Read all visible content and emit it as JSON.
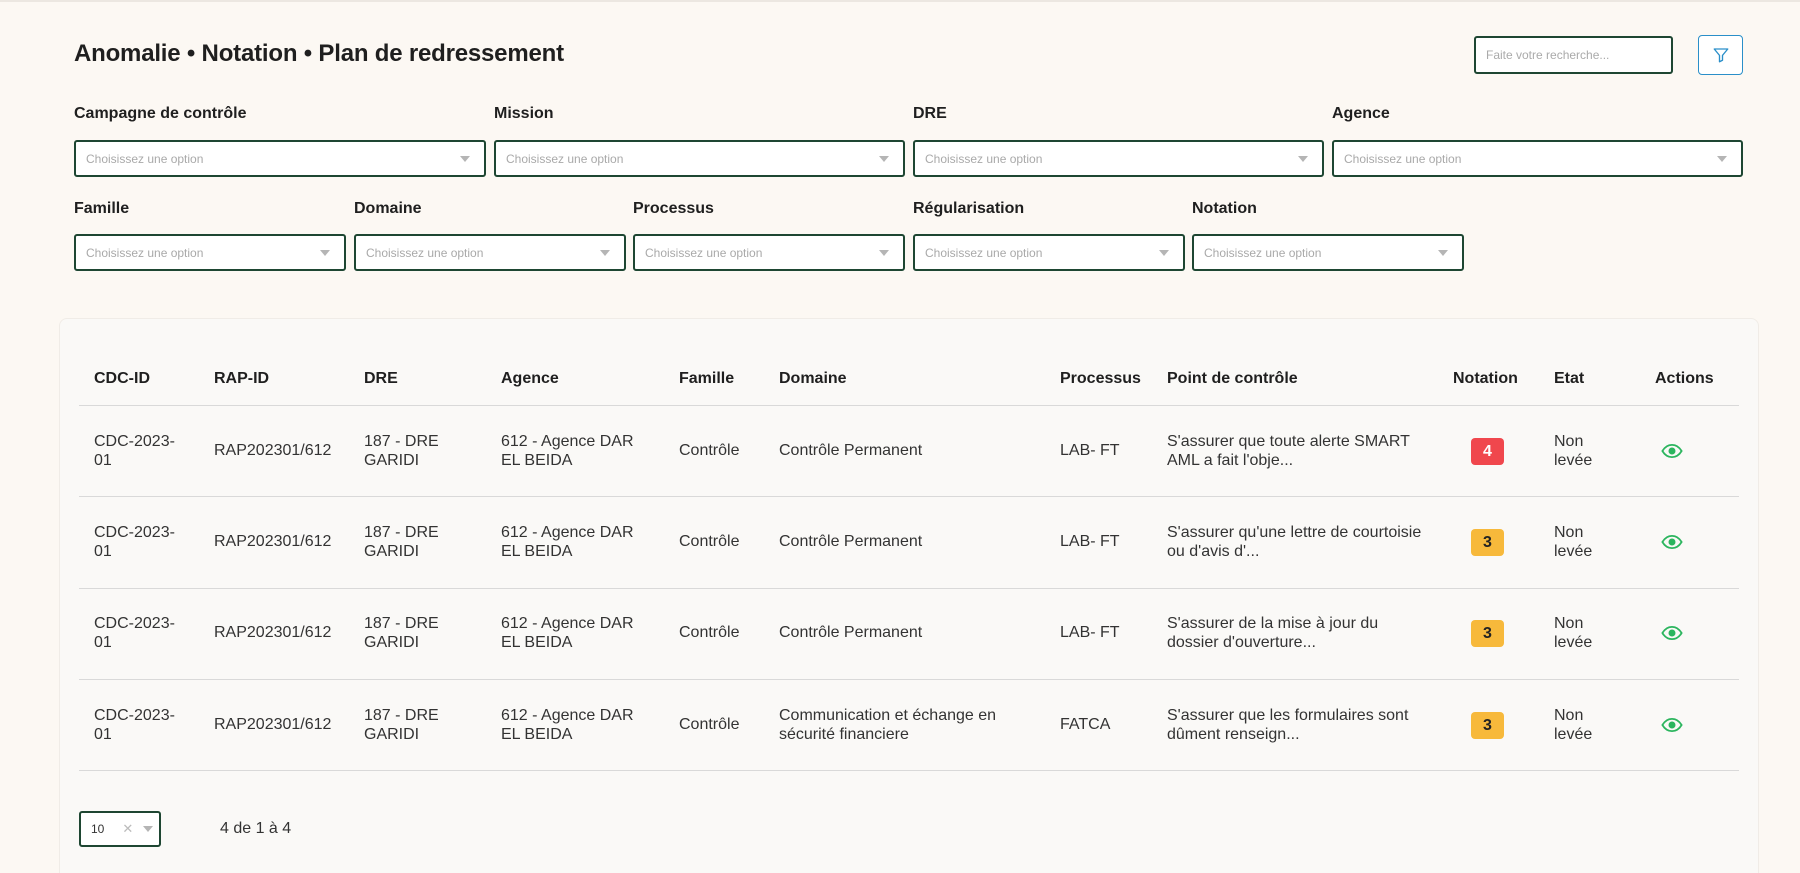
{
  "header": {
    "title": "Anomalie • Notation • Plan de redressement",
    "search_placeholder": "Faite votre recherche...",
    "filter_icon": "funnel-icon"
  },
  "filters": {
    "placeholder": "Choisissez une option",
    "row1": [
      {
        "label": "Campagne de contrôle"
      },
      {
        "label": "Mission"
      },
      {
        "label": "DRE"
      },
      {
        "label": "Agence"
      }
    ],
    "row2": [
      {
        "label": "Famille"
      },
      {
        "label": "Domaine"
      },
      {
        "label": "Processus"
      },
      {
        "label": "Régularisation"
      },
      {
        "label": "Notation"
      }
    ]
  },
  "table": {
    "columns": [
      "CDC-ID",
      "RAP-ID",
      "DRE",
      "Agence",
      "Famille",
      "Domaine",
      "Processus",
      "Point de contrôle",
      "Notation",
      "Etat",
      "Actions"
    ],
    "rows": [
      {
        "cdc1": "CDC-2023-",
        "cdc2": "01",
        "rap": "RAP202301/612",
        "dre1": "187 - DRE",
        "dre2": "GARIDI",
        "agence1": "612 - Agence DAR",
        "agence2": "EL BEIDA",
        "famille": "Contrôle",
        "domaine1": "Contrôle Permanent",
        "domaine2": "",
        "processus": "LAB- FT",
        "point1": "S'assurer que toute alerte SMART",
        "point2": "AML a fait l'obje...",
        "notation": "4",
        "notation_color": "#f0474d",
        "etat1": "Non",
        "etat2": "levée"
      },
      {
        "cdc1": "CDC-2023-",
        "cdc2": "01",
        "rap": "RAP202301/612",
        "dre1": "187 - DRE",
        "dre2": "GARIDI",
        "agence1": "612 - Agence DAR",
        "agence2": "EL BEIDA",
        "famille": "Contrôle",
        "domaine1": "Contrôle Permanent",
        "domaine2": "",
        "processus": "LAB- FT",
        "point1": "S'assurer qu'une lettre de courtoisie",
        "point2": "ou d'avis d'...",
        "notation": "3",
        "notation_color": "#f7b93b",
        "etat1": "Non",
        "etat2": "levée"
      },
      {
        "cdc1": "CDC-2023-",
        "cdc2": "01",
        "rap": "RAP202301/612",
        "dre1": "187 - DRE",
        "dre2": "GARIDI",
        "agence1": "612 - Agence DAR",
        "agence2": "EL BEIDA",
        "famille": "Contrôle",
        "domaine1": "Contrôle Permanent",
        "domaine2": "",
        "processus": "LAB- FT",
        "point1": "S'assurer de la mise à jour du",
        "point2": "dossier d'ouverture...",
        "notation": "3",
        "notation_color": "#f7b93b",
        "etat1": "Non",
        "etat2": "levée"
      },
      {
        "cdc1": "CDC-2023-",
        "cdc2": "01",
        "rap": "RAP202301/612",
        "dre1": "187 - DRE",
        "dre2": "GARIDI",
        "agence1": "612 - Agence DAR",
        "agence2": "EL BEIDA",
        "famille": "Contrôle",
        "domaine1": "Communication et échange en",
        "domaine2": "sécurité financiere",
        "processus": "FATCA",
        "point1": "S'assurer que les formulaires sont",
        "point2": "dûment renseign...",
        "notation": "3",
        "notation_color": "#f7b93b",
        "etat1": "Non",
        "etat2": "levée"
      }
    ],
    "action_icon": "eye-icon",
    "accent_color": "#2bb55e"
  },
  "pagination": {
    "page_size": "10",
    "summary": "4  de 1 à 4"
  }
}
